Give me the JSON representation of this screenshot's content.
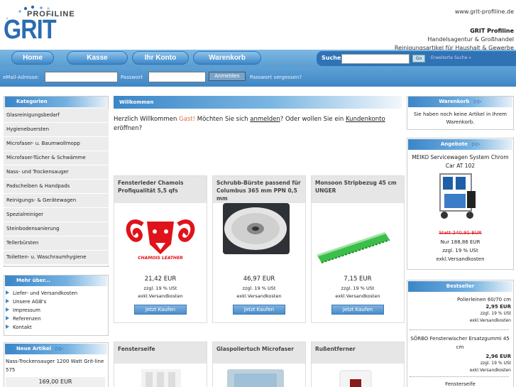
{
  "header": {
    "logo_top": "PROFILINE",
    "logo_main": "GRIT",
    "site_url": "www.grit-profiline.de",
    "company_name": "GRIT Profiline",
    "line1": "Handelsagentur & Großhandel",
    "line2": "Reinigungsartikel für Haushalt & Gewerbe"
  },
  "nav": {
    "items": [
      {
        "label": "Home"
      },
      {
        "label": "Kasse"
      },
      {
        "label": "Ihr Konto"
      },
      {
        "label": "Warenkorb"
      }
    ],
    "search_label": "Suche",
    "go_label": "Go",
    "advanced": "Erweiterte Suche »"
  },
  "login": {
    "email_label": "eMail-Adresse:",
    "password_label": "Passwort",
    "button": "Anmelden",
    "forgot": "Passwort vergessen?"
  },
  "categories": {
    "title": "Kategorien",
    "items": [
      "Glasreinigungsbedarf",
      "Hygienebuersten",
      "Microfaser- u. Baumwollmopp",
      "Microfaser-Tücher & Schwämme",
      "Nass- und Trockensauger",
      "Padscheiben & Handpads",
      "Reinigungs- & Gerätewagen",
      "Spezialreiniger",
      "Steinbodensanierung",
      "Tellerbürsten",
      "Toiletten- u. Waschraumhygiene"
    ]
  },
  "more": {
    "title": "Mehr über...",
    "items": [
      "Liefer- und Versandkosten",
      "Unsere AGB's",
      "Impressum",
      "Referenzen",
      "Kontakt"
    ]
  },
  "new_articles": {
    "title": "Neue Artikel",
    "name": "Nass-Trockensauger 1200 Watt Grit-line 575",
    "price": "169,00 EUR"
  },
  "main": {
    "title": "Willkommen",
    "welcome_1": "Herzlich Willkommen ",
    "guest": "Gast!",
    "welcome_2": " Möchten Sie sich ",
    "login_link": "anmelden",
    "welcome_3": "? Oder wollen Sie ein ",
    "account_link": "Kundenkonto",
    "welcome_4": "eröffnen?",
    "products": [
      {
        "name": "Fensterleder Chamois Profiqualität 5,5 qfs",
        "price": "21,42 EUR",
        "tax": "zzgl. 19 % USt",
        "shipping": "exkl.Versandkosten",
        "buy": "Jetzt Kaufen",
        "logo_text": "CHAMOIS LEATHER"
      },
      {
        "name": "Schrubb-Bürste passend für Columbus 365 mm PPN 0,5 mm",
        "price": "46,97 EUR",
        "tax": "zzgl. 19 % USt",
        "shipping": "exkl.Versandkosten",
        "buy": "Jetzt Kaufen"
      },
      {
        "name": "Monsoon Stripbezug 45 cm UNGER",
        "price": "7,15 EUR",
        "tax": "zzgl. 19 % USt",
        "shipping": "exkl.Versandkosten",
        "buy": "Jetzt Kaufen"
      },
      {
        "name": "Fensterseife"
      },
      {
        "name": "Glaspoliertuch Microfaser"
      },
      {
        "name": "Rußentferner"
      }
    ]
  },
  "cart": {
    "title": "Warenkorb",
    "text": "Sie haben noch keine Artikel in Ihrem Warenkorb."
  },
  "offers": {
    "title": "Angebote",
    "name": "MEIKO Servicewagen System Chrom Car AT 102",
    "old_price": "Statt 240,91 EUR",
    "new_price": "Nur 188,86 EUR",
    "tax": "zzgl. 19 % USt",
    "shipping": "exkl.Versandkosten"
  },
  "bestseller": {
    "title": "Bestseller",
    "items": [
      {
        "name": "Polierleinen 60/70 cm",
        "price": "2,95 EUR",
        "tax": "zzgl. 19 % USt",
        "shipping": "exkl.Versandkosten"
      },
      {
        "name": "SÖRBO Fensterwischer Ersatzgummi 45 cm",
        "price": "2,96 EUR",
        "tax": "zzgl. 19 % USt",
        "shipping": "exkl.Versandkosten"
      },
      {
        "name": "Fensterseife"
      }
    ]
  }
}
